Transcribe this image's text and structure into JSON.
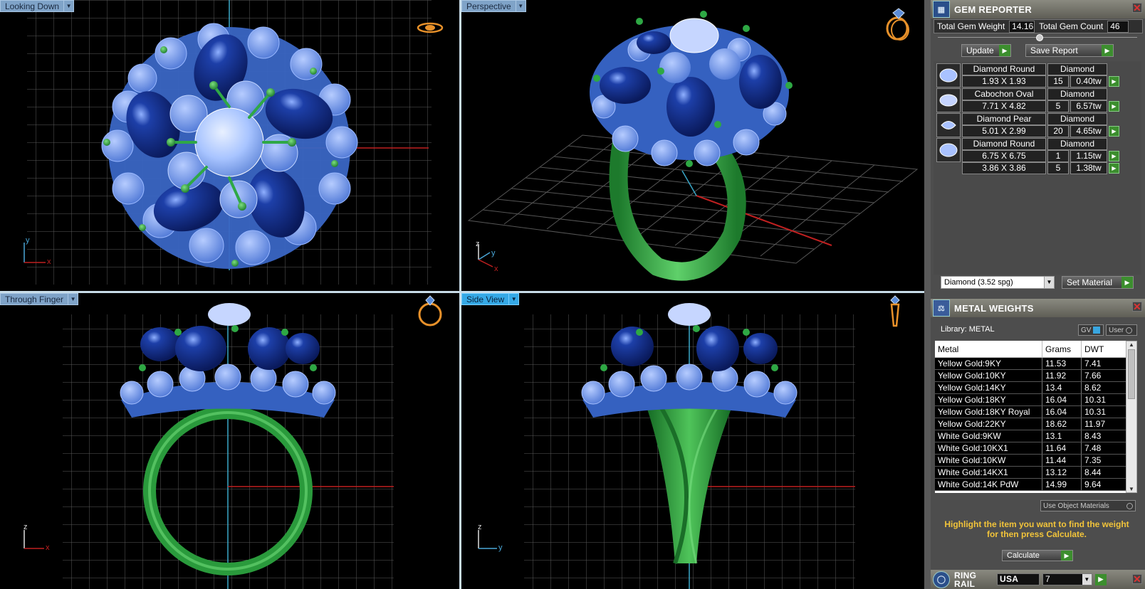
{
  "viewports": {
    "top_left": {
      "label": "Looking Down",
      "axis_x": "x",
      "axis_y": "y"
    },
    "top_right": {
      "label": "Perspective",
      "axis_x": "x",
      "axis_y": "y",
      "axis_z": "z"
    },
    "bottom_left": {
      "label": "Through Finger",
      "axis_x": "x",
      "axis_z": "z"
    },
    "bottom_right": {
      "label": "Side View",
      "axis_y": "y",
      "axis_z": "z"
    }
  },
  "gem_reporter": {
    "title": "GEM REPORTER",
    "total_weight_label": "Total Gem Weight",
    "total_weight": "14.16",
    "total_count_label": "Total Gem Count",
    "total_count": "46",
    "update_label": "Update",
    "save_report_label": "Save Report",
    "gems": [
      {
        "shape": "Diamond Round",
        "material": "Diamond",
        "size": "1.93 X 1.93",
        "count": "15",
        "weight": "0.40tw"
      },
      {
        "shape": "Cabochon Oval",
        "material": "Diamond",
        "size": "7.71 X 4.82",
        "count": "5",
        "weight": "6.57tw"
      },
      {
        "shape": "Diamond Pear",
        "material": "Diamond",
        "size": "5.01 X 2.99",
        "count": "20",
        "weight": "4.65tw"
      },
      {
        "shape": "Diamond Round",
        "material": "Diamond",
        "size": "6.75 X 6.75",
        "count": "1",
        "weight": "1.15tw",
        "size2": "3.86 X 3.86",
        "count2": "5",
        "weight2": "1.38tw"
      }
    ],
    "material_select": "Diamond     (3.52 spg)",
    "set_material_label": "Set Material"
  },
  "metal_weights": {
    "title": "METAL WEIGHTS",
    "library_label": "Library: METAL",
    "gv_label": "GV",
    "user_label": "User",
    "columns": [
      "Metal",
      "Grams",
      "DWT"
    ],
    "rows": [
      [
        "Yellow Gold:9KY",
        "11.53",
        "7.41"
      ],
      [
        "Yellow Gold:10KY",
        "11.92",
        "7.66"
      ],
      [
        "Yellow Gold:14KY",
        "13.4",
        "8.62"
      ],
      [
        "Yellow Gold:18KY",
        "16.04",
        "10.31"
      ],
      [
        "Yellow Gold:18KY Royal",
        "16.04",
        "10.31"
      ],
      [
        "Yellow Gold:22KY",
        "18.62",
        "11.97"
      ],
      [
        "White Gold:9KW",
        "13.1",
        "8.43"
      ],
      [
        "White Gold:10KX1",
        "11.64",
        "7.48"
      ],
      [
        "White Gold:10KW",
        "11.44",
        "7.35"
      ],
      [
        "White Gold:14KX1",
        "13.12",
        "8.44"
      ],
      [
        "White Gold:14K PdW",
        "14.99",
        "9.64"
      ]
    ],
    "use_object_materials_label": "Use Object Materials",
    "hint": "Highlight the item you want to find the weight for then press Calculate.",
    "calculate_label": "Calculate"
  },
  "ring_rail": {
    "title": "RING RAIL",
    "region": "USA",
    "size": "7"
  }
}
